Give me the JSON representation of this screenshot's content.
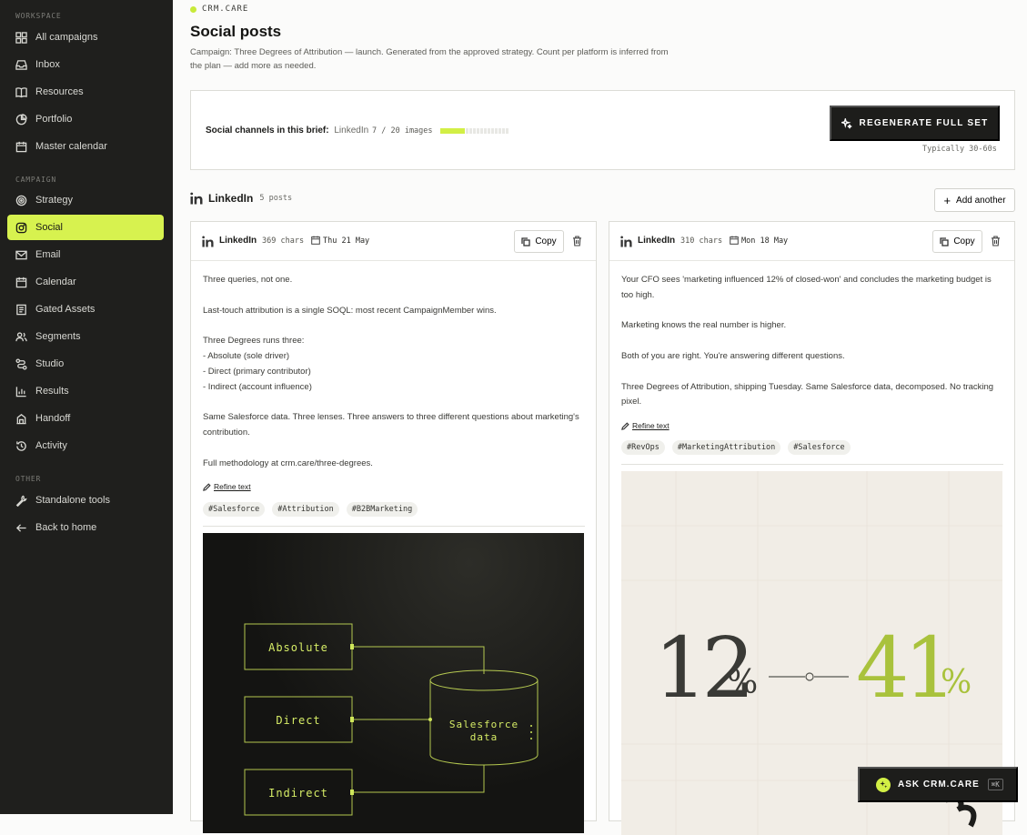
{
  "sidebar": {
    "sections": [
      {
        "label": "WORKSPACE",
        "items": [
          {
            "label": "All campaigns",
            "icon": "grid-icon"
          },
          {
            "label": "Inbox",
            "icon": "inbox-icon"
          },
          {
            "label": "Resources",
            "icon": "book-icon"
          },
          {
            "label": "Portfolio",
            "icon": "pie-chart-icon"
          },
          {
            "label": "Master calendar",
            "icon": "calendar-icon"
          }
        ]
      },
      {
        "label": "CAMPAIGN",
        "items": [
          {
            "label": "Strategy",
            "icon": "target-icon"
          },
          {
            "label": "Social",
            "icon": "instagram-icon",
            "active": true
          },
          {
            "label": "Email",
            "icon": "mail-icon"
          },
          {
            "label": "Calendar",
            "icon": "calendar-icon"
          },
          {
            "label": "Gated Assets",
            "icon": "document-icon"
          },
          {
            "label": "Segments",
            "icon": "users-icon"
          },
          {
            "label": "Studio",
            "icon": "route-icon"
          },
          {
            "label": "Results",
            "icon": "bar-chart-icon"
          },
          {
            "label": "Handoff",
            "icon": "handoff-icon"
          },
          {
            "label": "Activity",
            "icon": "history-icon"
          }
        ]
      },
      {
        "label": "OTHER",
        "items": [
          {
            "label": "Standalone tools",
            "icon": "wrench-icon"
          },
          {
            "label": "Back to home",
            "icon": "arrow-left-icon"
          }
        ]
      }
    ]
  },
  "header": {
    "brand": "CRM.CARE",
    "title": "Social posts",
    "description": "Campaign: Three Degrees of Attribution — launch. Generated from the approved strategy. Count per platform is inferred from the plan — add more as needed."
  },
  "brief": {
    "label": "Social channels in this brief:",
    "channels": "LinkedIn",
    "images_text": "7 / 20 images",
    "images_progress": 0.35,
    "regen_label": "REGENERATE FULL SET",
    "regen_sub": "Typically 30-60s"
  },
  "platform": {
    "name": "LinkedIn",
    "count": "5 posts",
    "add_label": "Add another"
  },
  "posts": [
    {
      "platform": "LinkedIn",
      "chars": "369 chars",
      "date": "Thu 21 May",
      "copy_label": "Copy",
      "paragraphs": [
        "Three queries, not one.",
        "Last-touch attribution is a single SOQL: most recent CampaignMember wins.",
        "Three Degrees runs three:\n- Absolute (sole driver)\n- Direct (primary contributor)\n- Indirect (account influence)",
        "Same Salesforce data. Three lenses. Three answers to three different questions about marketing's contribution.",
        "Full methodology at crm.care/three-degrees."
      ],
      "refine_label": "Refine text",
      "tags": [
        "#Salesforce",
        "#Attribution",
        "#B2BMarketing"
      ],
      "image": {
        "boxes": [
          "Absolute",
          "Direct",
          "Indirect"
        ],
        "db_label_1": "Salesforce",
        "db_label_2": "data"
      }
    },
    {
      "platform": "LinkedIn",
      "chars": "310 chars",
      "date": "Mon 18 May",
      "copy_label": "Copy",
      "paragraphs": [
        "Your CFO sees 'marketing influenced 12% of closed-won' and concludes the marketing budget is too high.",
        "Marketing knows the real number is higher.",
        "Both of you are right. You're answering different questions.",
        "Three Degrees of Attribution, shipping Tuesday. Same Salesforce data, decomposed. No tracking pixel."
      ],
      "refine_label": "Refine text",
      "tags": [
        "#RevOps",
        "#MarketingAttribution",
        "#Salesforce"
      ],
      "image": {
        "left_num": "12",
        "right_num": "41",
        "pct": "%"
      }
    }
  ],
  "ask": {
    "label": "ASK CRM.CARE",
    "shortcut": "⌘K"
  },
  "colors": {
    "accent": "#d7f24f",
    "sidebar_bg": "#1f1f1d",
    "dark_button": "#1d1d1b",
    "image_green": "#a9c23c"
  }
}
